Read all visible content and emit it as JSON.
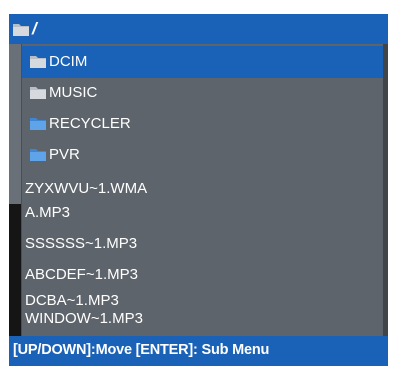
{
  "header": {
    "path": "/",
    "icon": "folder-icon"
  },
  "folders": [
    {
      "label": "DCIM",
      "selected": true,
      "icon": "folder-icon"
    },
    {
      "label": "MUSIC",
      "selected": false,
      "icon": "folder-icon"
    },
    {
      "label": "RECYCLER",
      "selected": false,
      "icon": "folder-icon"
    },
    {
      "label": "PVR",
      "selected": false,
      "icon": "folder-icon"
    }
  ],
  "files": [
    "ZYXWVU~1.WMA",
    "A.MP3",
    "SSSSSS~1.MP3",
    "ABCDEF~1.MP3",
    "DCBA~1.MP3",
    "WINDOW~1.MP3"
  ],
  "footer": {
    "hint": "[UP/DOWN]:Move [ENTER]: Sub Menu"
  },
  "colors": {
    "accent": "#1a62b8",
    "panel": "#5e646b",
    "text": "#ffffff"
  }
}
